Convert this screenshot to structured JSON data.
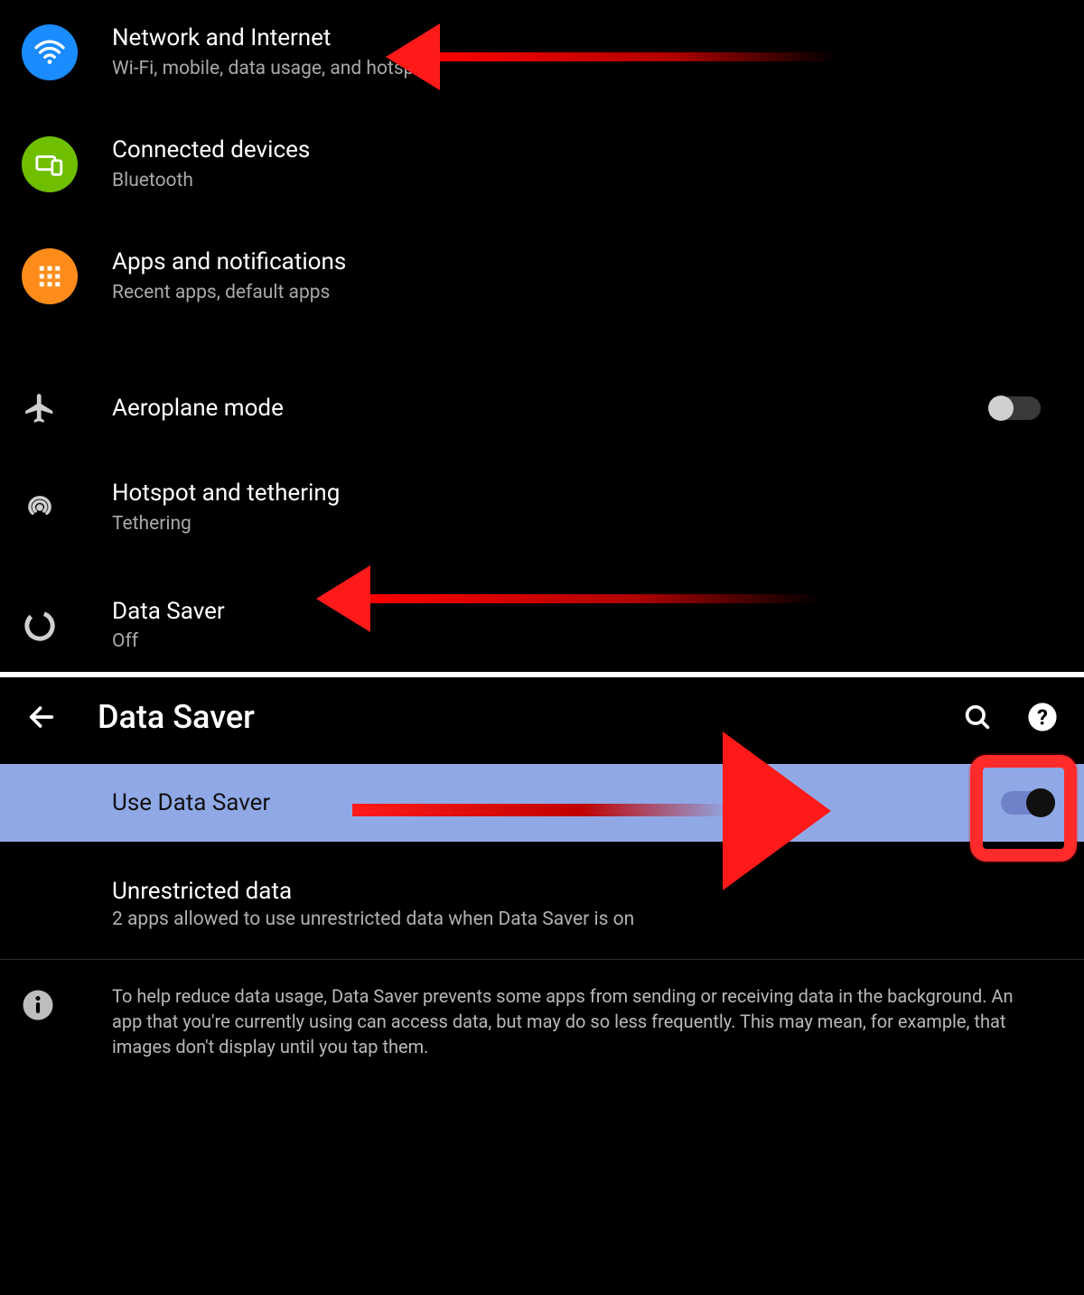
{
  "panel1": {
    "items": [
      {
        "title": "Network and Internet",
        "subtitle": "Wi-Fi, mobile, data usage, and hotspot"
      },
      {
        "title": "Connected devices",
        "subtitle": "Bluetooth"
      },
      {
        "title": "Apps and notifications",
        "subtitle": "Recent apps, default apps"
      },
      {
        "title": "Aeroplane mode",
        "toggle": "off"
      },
      {
        "title": "Hotspot and tethering",
        "subtitle": "Tethering"
      },
      {
        "title": "Data Saver",
        "subtitle": "Off"
      }
    ]
  },
  "panel2": {
    "appbar_title": "Data Saver",
    "use_data_saver_label": "Use Data Saver",
    "use_data_saver_toggle": "on",
    "unrestricted": {
      "title": "Unrestricted data",
      "subtitle": "2 apps allowed to use unrestricted data when Data Saver is on"
    },
    "info_text": "To help reduce data usage, Data Saver prevents some apps from sending or receiving data in the background. An app that you're currently using can access data, but may do so less frequently. This may mean, for example, that images don't display until you tap them."
  },
  "colors": {
    "highlight_bg": "#90a9e6",
    "accent_arrow": "#ff1a1a"
  }
}
